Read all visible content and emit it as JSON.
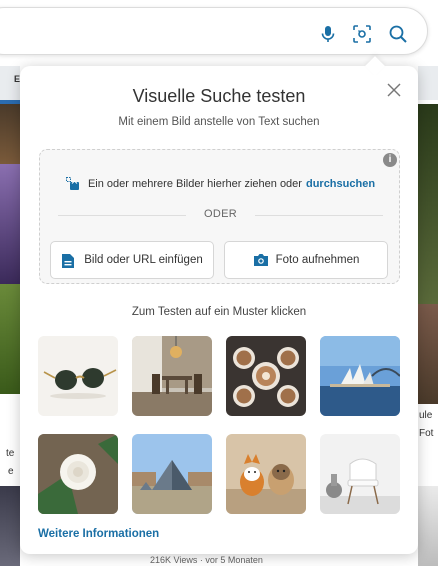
{
  "flyout": {
    "title": "Visuelle Suche testen",
    "subtitle": "Mit einem Bild anstelle von Text suchen",
    "dropzone": {
      "text": "Ein oder mehrere Bilder hierher ziehen oder",
      "link": "durchsuchen",
      "or": "ODER",
      "url_button": "Bild oder URL einfügen",
      "photo_button": "Foto aufnehmen"
    },
    "samples_label": "Zum Testen auf ein Muster klicken",
    "samples": [
      {
        "icon": "sunglasses-image"
      },
      {
        "icon": "dining-room-image"
      },
      {
        "icon": "coffee-cups-image"
      },
      {
        "icon": "sydney-opera-house-image"
      },
      {
        "icon": "white-rose-image"
      },
      {
        "icon": "louvre-pyramid-image"
      },
      {
        "icon": "dogs-image"
      },
      {
        "icon": "chair-image"
      }
    ],
    "more_link": "Weitere Informationen"
  },
  "background": {
    "tab_letter": "E",
    "left_text_1": "te",
    "left_text_2": "e",
    "right_text_1": "ule",
    "right_text_2": "Fot",
    "bottom_text": "216K Views · vor 5 Monaten"
  },
  "colors": {
    "link": "#1a6fa5",
    "icon_blue": "#1a6fa5",
    "icon_dark": "#444444"
  }
}
